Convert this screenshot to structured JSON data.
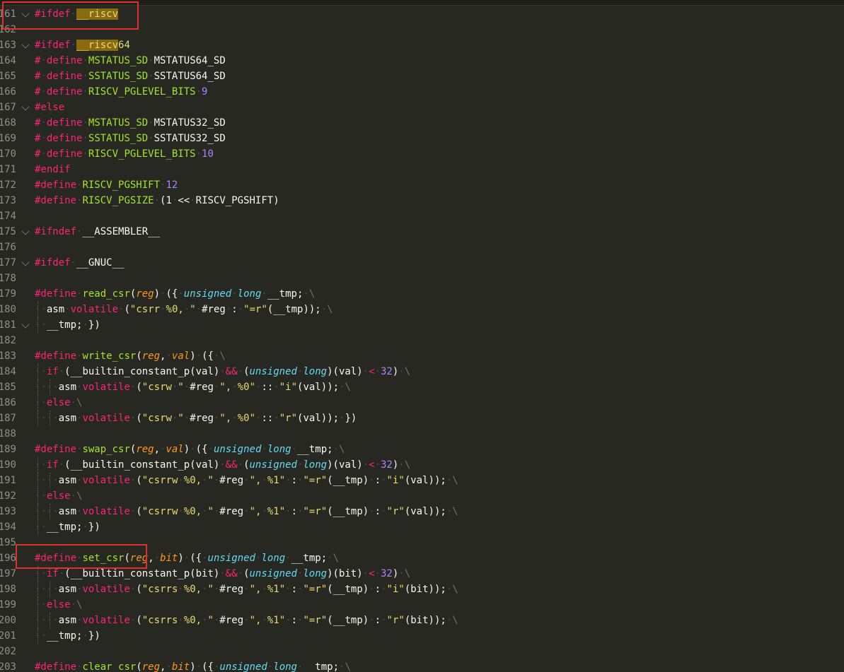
{
  "editor": {
    "lines": [
      {
        "num": "161",
        "fold": true,
        "t": [
          [
            "k",
            "#ifdef"
          ],
          [
            "",
            "·"
          ],
          [
            "hl",
            "__riscv"
          ]
        ]
      },
      {
        "num": "162",
        "t": []
      },
      {
        "num": "163",
        "fold": true,
        "t": [
          [
            "k",
            "#ifdef"
          ],
          [
            "",
            "·"
          ],
          [
            "hl",
            "__riscv"
          ],
          [
            "s",
            "64"
          ]
        ]
      },
      {
        "num": "164",
        "t": [
          [
            "k",
            "#·define"
          ],
          [
            "",
            "·"
          ],
          [
            "e",
            "MSTATUS_SD"
          ],
          [
            "",
            "·MSTATUS64_SD"
          ]
        ]
      },
      {
        "num": "165",
        "t": [
          [
            "k",
            "#·define"
          ],
          [
            "",
            "·"
          ],
          [
            "e",
            "SSTATUS_SD"
          ],
          [
            "",
            "·SSTATUS64_SD"
          ]
        ]
      },
      {
        "num": "166",
        "t": [
          [
            "k",
            "#·define"
          ],
          [
            "",
            "·"
          ],
          [
            "e",
            "RISCV_PGLEVEL_BITS"
          ],
          [
            "",
            "·"
          ],
          [
            "n",
            "9"
          ]
        ]
      },
      {
        "num": "167",
        "fold": true,
        "t": [
          [
            "k",
            "#else"
          ]
        ]
      },
      {
        "num": "168",
        "t": [
          [
            "k",
            "#·define"
          ],
          [
            "",
            "·"
          ],
          [
            "e",
            "MSTATUS_SD"
          ],
          [
            "",
            "·MSTATUS32_SD"
          ]
        ]
      },
      {
        "num": "169",
        "t": [
          [
            "k",
            "#·define"
          ],
          [
            "",
            "·"
          ],
          [
            "e",
            "SSTATUS_SD"
          ],
          [
            "",
            "·SSTATUS32_SD"
          ]
        ]
      },
      {
        "num": "170",
        "t": [
          [
            "k",
            "#·define"
          ],
          [
            "",
            "·"
          ],
          [
            "e",
            "RISCV_PGLEVEL_BITS"
          ],
          [
            "",
            "·"
          ],
          [
            "n",
            "10"
          ]
        ]
      },
      {
        "num": "171",
        "t": [
          [
            "k",
            "#endif"
          ]
        ]
      },
      {
        "num": "172",
        "t": [
          [
            "k",
            "#define"
          ],
          [
            "",
            "·"
          ],
          [
            "e",
            "RISCV_PGSHIFT"
          ],
          [
            "",
            "·"
          ],
          [
            "n",
            "12"
          ]
        ]
      },
      {
        "num": "173",
        "t": [
          [
            "k",
            "#define"
          ],
          [
            "",
            "·"
          ],
          [
            "e",
            "RISCV_PGSIZE"
          ],
          [
            "",
            "·(1·<<·RISCV_PGSHIFT)"
          ]
        ]
      },
      {
        "num": "174",
        "t": []
      },
      {
        "num": "175",
        "fold": true,
        "t": [
          [
            "k",
            "#ifndef"
          ],
          [
            "",
            "·__ASSEMBLER__"
          ]
        ]
      },
      {
        "num": "176",
        "t": []
      },
      {
        "num": "177",
        "fold": true,
        "t": [
          [
            "k",
            "#ifdef"
          ],
          [
            "",
            "·__GNUC__"
          ]
        ]
      },
      {
        "num": "178",
        "t": []
      },
      {
        "num": "179",
        "t": [
          [
            "k",
            "#define"
          ],
          [
            "",
            "·"
          ],
          [
            "e",
            "read_csr"
          ],
          [
            "",
            "("
          ],
          [
            "p",
            "reg"
          ],
          [
            "",
            ")·({·"
          ],
          [
            "t",
            "unsigned"
          ],
          [
            "",
            "·"
          ],
          [
            "t",
            "long"
          ],
          [
            "",
            "·__tmp;·"
          ],
          [
            "cm",
            "\\"
          ]
        ]
      },
      {
        "num": "180",
        "indent": 1,
        "t": [
          [
            "",
            "··asm·"
          ],
          [
            "k",
            "volatile"
          ],
          [
            "",
            "·("
          ],
          [
            "s",
            "\"csrr·%0,·\""
          ],
          [
            "",
            "·#reg·:·"
          ],
          [
            "s",
            "\"=r\""
          ],
          [
            "",
            "(__tmp));·"
          ],
          [
            "cm",
            "\\"
          ]
        ]
      },
      {
        "num": "181",
        "indent": 1,
        "fold": true,
        "t": [
          [
            "",
            "··__tmp;·})"
          ]
        ]
      },
      {
        "num": "182",
        "t": []
      },
      {
        "num": "183",
        "t": [
          [
            "k",
            "#define"
          ],
          [
            "",
            "·"
          ],
          [
            "e",
            "write_csr"
          ],
          [
            "",
            "("
          ],
          [
            "p",
            "reg"
          ],
          [
            "",
            ",·"
          ],
          [
            "p",
            "val"
          ],
          [
            "",
            ")·({·"
          ],
          [
            "cm",
            "\\"
          ]
        ]
      },
      {
        "num": "184",
        "indent": 1,
        "t": [
          [
            "",
            "··"
          ],
          [
            "k",
            "if"
          ],
          [
            "",
            "·(__builtin_constant_p(val)·"
          ],
          [
            "op",
            "&&"
          ],
          [
            "",
            "·("
          ],
          [
            "t",
            "unsigned"
          ],
          [
            "",
            "·"
          ],
          [
            "t",
            "long"
          ],
          [
            "",
            ")(val)·"
          ],
          [
            "op",
            "<"
          ],
          [
            "",
            "·"
          ],
          [
            "n",
            "32"
          ],
          [
            "",
            ")·"
          ],
          [
            "cm",
            "\\"
          ]
        ]
      },
      {
        "num": "185",
        "indent": 2,
        "t": [
          [
            "",
            "····asm·"
          ],
          [
            "k",
            "volatile"
          ],
          [
            "",
            "·("
          ],
          [
            "s",
            "\"csrw·\""
          ],
          [
            "",
            "·#reg·"
          ],
          [
            "s",
            "\",·%0\""
          ],
          [
            "",
            "·::·"
          ],
          [
            "s",
            "\"i\""
          ],
          [
            "",
            "(val));·"
          ],
          [
            "cm",
            "\\"
          ]
        ]
      },
      {
        "num": "186",
        "indent": 1,
        "t": [
          [
            "",
            "··"
          ],
          [
            "k",
            "else"
          ],
          [
            "",
            "·"
          ],
          [
            "cm",
            "\\"
          ]
        ]
      },
      {
        "num": "187",
        "indent": 2,
        "t": [
          [
            "",
            "····asm·"
          ],
          [
            "k",
            "volatile"
          ],
          [
            "",
            "·("
          ],
          [
            "s",
            "\"csrw·\""
          ],
          [
            "",
            "·#reg·"
          ],
          [
            "s",
            "\",·%0\""
          ],
          [
            "",
            "·::·"
          ],
          [
            "s",
            "\"r\""
          ],
          [
            "",
            "(val));·})"
          ]
        ]
      },
      {
        "num": "188",
        "t": []
      },
      {
        "num": "189",
        "t": [
          [
            "k",
            "#define"
          ],
          [
            "",
            "·"
          ],
          [
            "e",
            "swap_csr"
          ],
          [
            "",
            "("
          ],
          [
            "p",
            "reg"
          ],
          [
            "",
            ",·"
          ],
          [
            "p",
            "val"
          ],
          [
            "",
            ")·({·"
          ],
          [
            "t",
            "unsigned"
          ],
          [
            "",
            "·"
          ],
          [
            "t",
            "long"
          ],
          [
            "",
            "·__tmp;·"
          ],
          [
            "cm",
            "\\"
          ]
        ]
      },
      {
        "num": "190",
        "indent": 1,
        "t": [
          [
            "",
            "··"
          ],
          [
            "k",
            "if"
          ],
          [
            "",
            "·(__builtin_constant_p(val)·"
          ],
          [
            "op",
            "&&"
          ],
          [
            "",
            "·("
          ],
          [
            "t",
            "unsigned"
          ],
          [
            "",
            "·"
          ],
          [
            "t",
            "long"
          ],
          [
            "",
            ")(val)·"
          ],
          [
            "op",
            "<"
          ],
          [
            "",
            "·"
          ],
          [
            "n",
            "32"
          ],
          [
            "",
            ")·"
          ],
          [
            "cm",
            "\\"
          ]
        ]
      },
      {
        "num": "191",
        "indent": 2,
        "t": [
          [
            "",
            "····asm·"
          ],
          [
            "k",
            "volatile"
          ],
          [
            "",
            "·("
          ],
          [
            "s",
            "\"csrrw·%0,·\""
          ],
          [
            "",
            "·#reg·"
          ],
          [
            "s",
            "\",·%1\""
          ],
          [
            "",
            "·:·"
          ],
          [
            "s",
            "\"=r\""
          ],
          [
            "",
            "(__tmp)·:·"
          ],
          [
            "s",
            "\"i\""
          ],
          [
            "",
            "(val));·"
          ],
          [
            "cm",
            "\\"
          ]
        ]
      },
      {
        "num": "192",
        "indent": 1,
        "t": [
          [
            "",
            "··"
          ],
          [
            "k",
            "else"
          ],
          [
            "",
            "·"
          ],
          [
            "cm",
            "\\"
          ]
        ]
      },
      {
        "num": "193",
        "indent": 2,
        "t": [
          [
            "",
            "····asm·"
          ],
          [
            "k",
            "volatile"
          ],
          [
            "",
            "·("
          ],
          [
            "s",
            "\"csrrw·%0,·\""
          ],
          [
            "",
            "·#reg·"
          ],
          [
            "s",
            "\",·%1\""
          ],
          [
            "",
            "·:·"
          ],
          [
            "s",
            "\"=r\""
          ],
          [
            "",
            "(__tmp)·:·"
          ],
          [
            "s",
            "\"r\""
          ],
          [
            "",
            "(val));·"
          ],
          [
            "cm",
            "\\"
          ]
        ]
      },
      {
        "num": "194",
        "indent": 1,
        "t": [
          [
            "",
            "··__tmp;·})"
          ]
        ]
      },
      {
        "num": "195",
        "t": []
      },
      {
        "num": "196",
        "t": [
          [
            "k",
            "#define"
          ],
          [
            "",
            "·"
          ],
          [
            "e",
            "set_csr"
          ],
          [
            "",
            "("
          ],
          [
            "p",
            "reg"
          ],
          [
            "",
            ",·"
          ],
          [
            "p",
            "bit"
          ],
          [
            "",
            ")·({·"
          ],
          [
            "t",
            "unsigned"
          ],
          [
            "",
            "·"
          ],
          [
            "t",
            "long"
          ],
          [
            "",
            "·__tmp;·"
          ],
          [
            "cm",
            "\\"
          ]
        ]
      },
      {
        "num": "197",
        "indent": 1,
        "t": [
          [
            "",
            "··"
          ],
          [
            "k",
            "if"
          ],
          [
            "",
            "·(__builtin_constant_p(bit)·"
          ],
          [
            "op",
            "&&"
          ],
          [
            "",
            "·("
          ],
          [
            "t",
            "unsigned"
          ],
          [
            "",
            "·"
          ],
          [
            "t",
            "long"
          ],
          [
            "",
            ")(bit)·"
          ],
          [
            "op",
            "<"
          ],
          [
            "",
            "·"
          ],
          [
            "n",
            "32"
          ],
          [
            "",
            ")·"
          ],
          [
            "cm",
            "\\"
          ]
        ]
      },
      {
        "num": "198",
        "indent": 2,
        "t": [
          [
            "",
            "····asm·"
          ],
          [
            "k",
            "volatile"
          ],
          [
            "",
            "·("
          ],
          [
            "s",
            "\"csrrs·%0,·\""
          ],
          [
            "",
            "·#reg·"
          ],
          [
            "s",
            "\",·%1\""
          ],
          [
            "",
            "·:·"
          ],
          [
            "s",
            "\"=r\""
          ],
          [
            "",
            "(__tmp)·:·"
          ],
          [
            "s",
            "\"i\""
          ],
          [
            "",
            "(bit));·"
          ],
          [
            "cm",
            "\\"
          ]
        ]
      },
      {
        "num": "199",
        "indent": 1,
        "t": [
          [
            "",
            "··"
          ],
          [
            "k",
            "else"
          ],
          [
            "",
            "·"
          ],
          [
            "cm",
            "\\"
          ]
        ]
      },
      {
        "num": "200",
        "indent": 2,
        "t": [
          [
            "",
            "····asm·"
          ],
          [
            "k",
            "volatile"
          ],
          [
            "",
            "·("
          ],
          [
            "s",
            "\"csrrs·%0,·\""
          ],
          [
            "",
            "·#reg·"
          ],
          [
            "s",
            "\",·%1\""
          ],
          [
            "",
            "·:·"
          ],
          [
            "s",
            "\"=r\""
          ],
          [
            "",
            "(__tmp)·:·"
          ],
          [
            "s",
            "\"r\""
          ],
          [
            "",
            "(bit));·"
          ],
          [
            "cm",
            "\\"
          ]
        ]
      },
      {
        "num": "201",
        "indent": 1,
        "t": [
          [
            "",
            "··__tmp;·})"
          ]
        ]
      },
      {
        "num": "202",
        "t": []
      },
      {
        "num": "203",
        "t": [
          [
            "k",
            "#define"
          ],
          [
            "",
            "·"
          ],
          [
            "e",
            "clear_csr"
          ],
          [
            "",
            "("
          ],
          [
            "p",
            "reg"
          ],
          [
            "",
            ",·"
          ],
          [
            "p",
            "bit"
          ],
          [
            "",
            ")·({·"
          ],
          [
            "t",
            "unsigned"
          ],
          [
            "",
            "·"
          ],
          [
            "t",
            "long"
          ],
          [
            "",
            "·__tmp;·"
          ],
          [
            "cm",
            "\\"
          ]
        ]
      }
    ]
  },
  "colors": {
    "background": "#272822",
    "keyword": "#f92672",
    "entity": "#a6e22e",
    "string": "#e6db74",
    "number": "#ae81ff",
    "type": "#66d9ef",
    "parameter": "#fd971f",
    "annotation_box": "#e0302a"
  }
}
